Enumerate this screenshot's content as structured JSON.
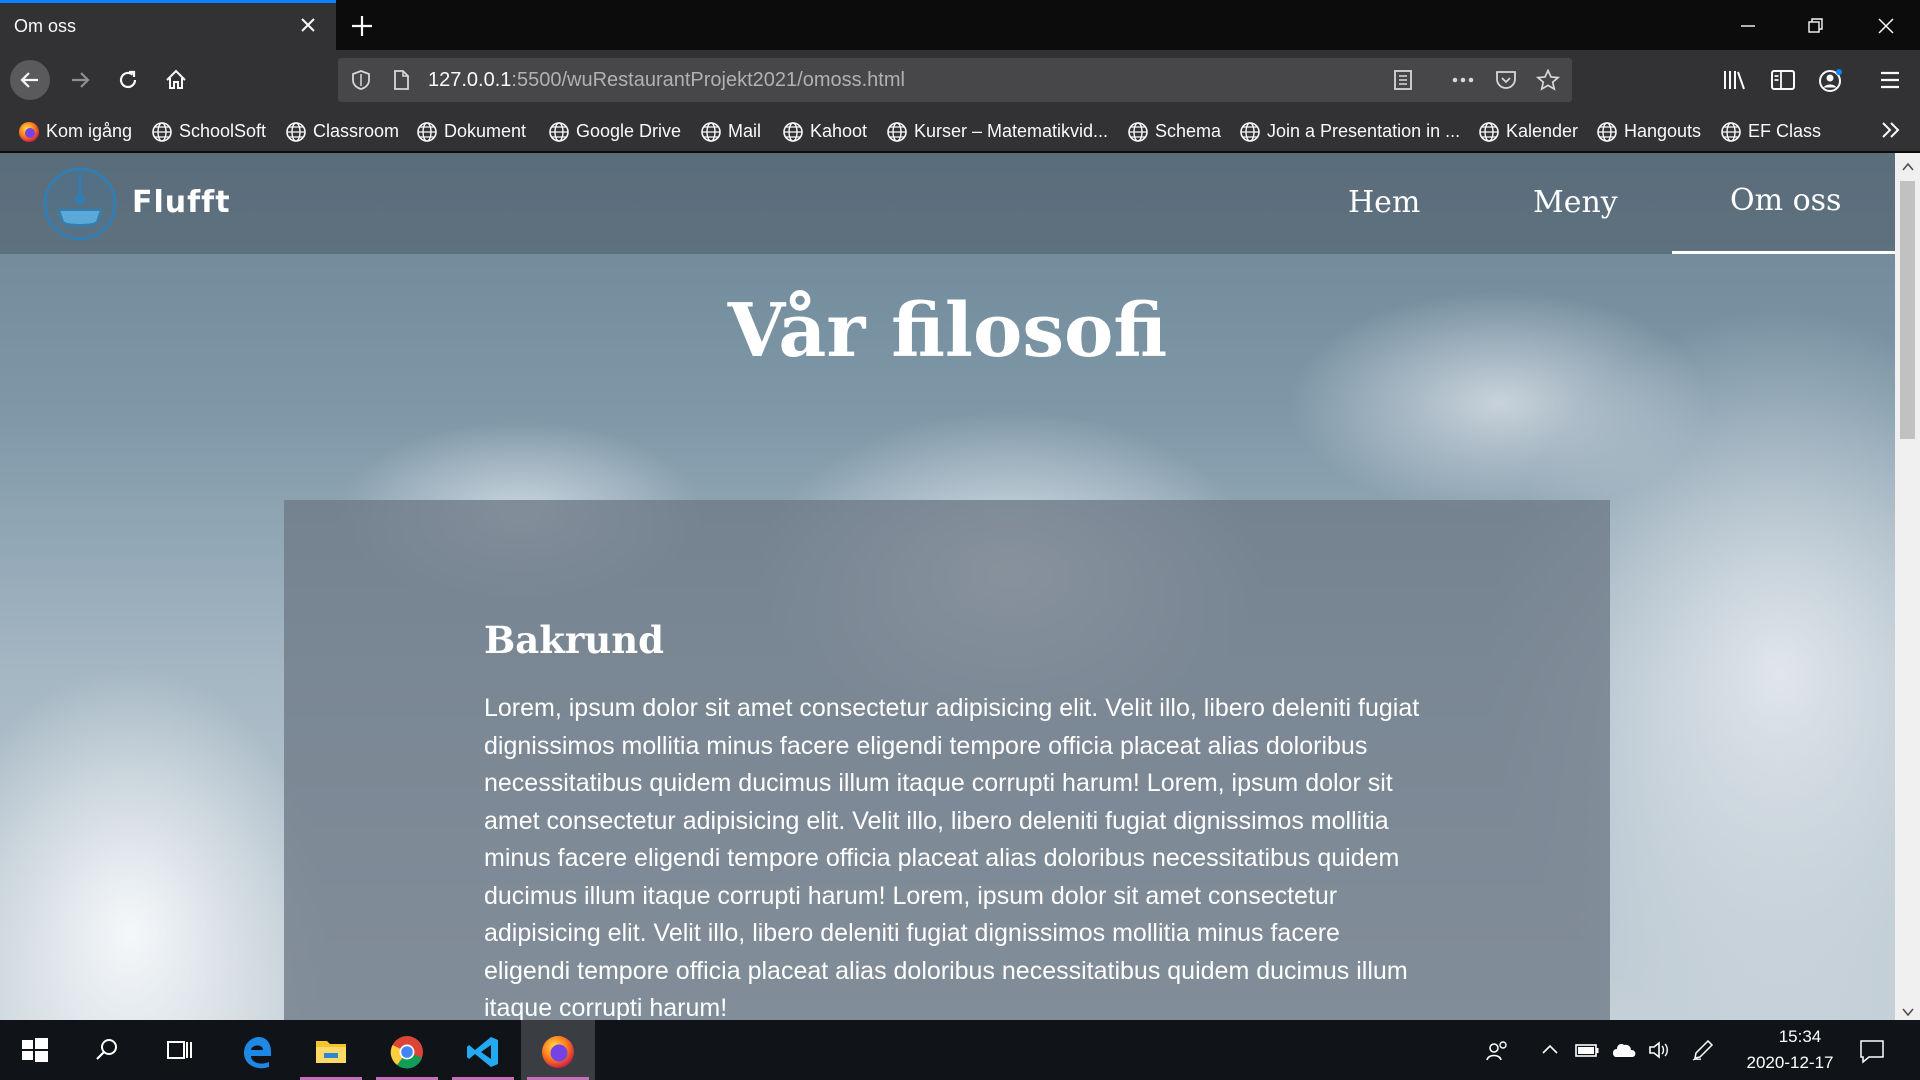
{
  "browser": {
    "tab_title": "Om oss",
    "url_host": "127.0.0.1",
    "url_path": ":5500/wuRestaurantProjekt2021/omoss.html"
  },
  "bookmarks": [
    {
      "label": "Kom igång",
      "icon": "firefox-icon"
    },
    {
      "label": "SchoolSoft",
      "icon": "globe-icon"
    },
    {
      "label": "Classroom",
      "icon": "globe-icon"
    },
    {
      "label": "Dokument",
      "icon": "globe-icon"
    },
    {
      "label": "Google Drive",
      "icon": "globe-icon"
    },
    {
      "label": "Mail",
      "icon": "globe-icon"
    },
    {
      "label": "Kahoot",
      "icon": "globe-icon"
    },
    {
      "label": "Kurser – Matematikvid...",
      "icon": "globe-icon"
    },
    {
      "label": "Schema",
      "icon": "globe-icon"
    },
    {
      "label": "Join a Presentation in ...",
      "icon": "globe-icon"
    },
    {
      "label": "Kalender",
      "icon": "globe-icon"
    },
    {
      "label": "Hangouts",
      "icon": "globe-icon"
    },
    {
      "label": "EF Class",
      "icon": "globe-icon"
    }
  ],
  "site": {
    "brand": "Flufft",
    "menu": [
      "Hem",
      "Meny",
      "Om oss"
    ],
    "active_menu": "Om oss",
    "page_title": "Vår filosofi",
    "section_heading": "Bakrund",
    "section_text": "Lorem, ipsum dolor sit amet consectetur adipisicing elit. Velit illo, libero deleniti fugiat dignissimos mollitia minus facere eligendi tempore officia placeat alias doloribus necessitatibus quidem ducimus illum itaque corrupti harum! Lorem, ipsum dolor sit amet consectetur adipisicing elit. Velit illo, libero deleniti fugiat dignissimos mollitia minus facere eligendi tempore officia placeat alias doloribus necessitatibus quidem ducimus illum itaque corrupti harum! Lorem, ipsum dolor sit amet consectetur adipisicing elit. Velit illo, libero deleniti fugiat dignissimos mollitia minus facere eligendi tempore officia placeat alias doloribus necessitatibus quidem ducimus illum itaque corrupti harum!"
  },
  "taskbar": {
    "apps": [
      "start-icon",
      "search-icon",
      "task-view-icon",
      "edge-icon",
      "file-explorer-icon",
      "chrome-icon",
      "vscode-icon",
      "firefox-icon"
    ],
    "time": "15:34",
    "date": "2020-12-17"
  },
  "colors": {
    "tab_accent": "#0a84ff",
    "chrome_dark": "#323234",
    "taskbar": "#101418"
  }
}
